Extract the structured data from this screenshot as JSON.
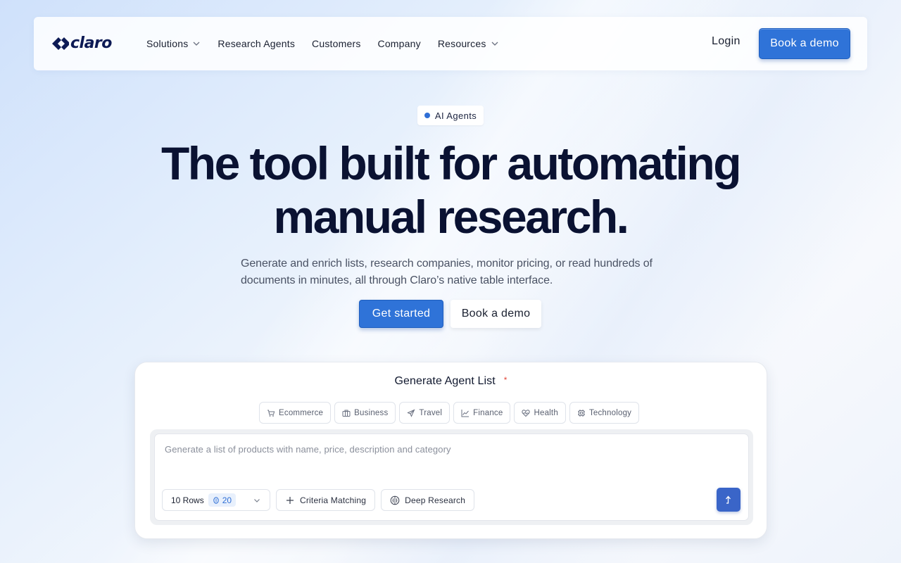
{
  "brand": {
    "name": "claro"
  },
  "nav": {
    "items": [
      {
        "label": "Solutions",
        "dropdown": true
      },
      {
        "label": "Research Agents",
        "dropdown": false
      },
      {
        "label": "Customers",
        "dropdown": false
      },
      {
        "label": "Company",
        "dropdown": false
      },
      {
        "label": "Resources",
        "dropdown": true
      }
    ],
    "login": "Login",
    "demo": "Book a demo"
  },
  "hero": {
    "badge": "AI Agents",
    "title": "The tool built for automating manual research.",
    "subtitle": "Generate and enrich lists, research companies, monitor pricing, or read hundreds of documents in minutes, all through Claro’s native table interface.",
    "primary_cta": "Get started",
    "secondary_cta": "Book a demo"
  },
  "agent_card": {
    "title": "Generate Agent List",
    "required_mark": "*",
    "categories": [
      {
        "label": "Ecommerce",
        "icon": "cart-icon"
      },
      {
        "label": "Business",
        "icon": "briefcase-icon"
      },
      {
        "label": "Travel",
        "icon": "plane-icon"
      },
      {
        "label": "Finance",
        "icon": "chart-icon"
      },
      {
        "label": "Health",
        "icon": "heart-pulse-icon"
      },
      {
        "label": "Technology",
        "icon": "chip-icon"
      }
    ],
    "prompt_placeholder": "Generate a list of products with name, price, description and category",
    "rows_label": "10 Rows",
    "credits": "20",
    "criteria_label": "Criteria Matching",
    "deep_research_label": "Deep Research"
  },
  "colors": {
    "accent": "#2f73d8",
    "brand_dark": "#0d1a55",
    "required": "#e2473a"
  }
}
